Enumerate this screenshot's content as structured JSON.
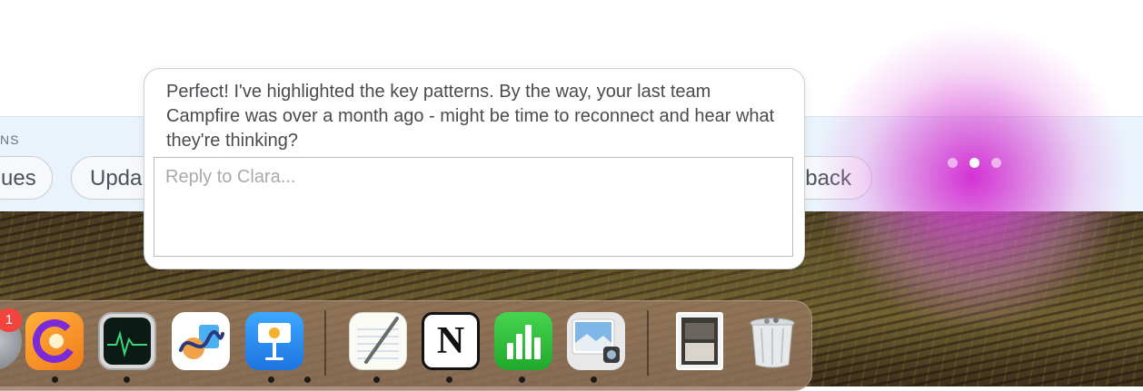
{
  "chat": {
    "message": "Perfect! I've highlighted the key patterns. By the way, your last team Campfire was over a month ago - might be time to reconnect and hear what they're thinking?",
    "reply_placeholder": "Reply to Clara..."
  },
  "suggestions": {
    "heading": "NS",
    "pills": [
      "ues",
      "Upda",
      "back"
    ]
  },
  "dock": {
    "badge_count": "1",
    "apps": [
      "system-settings",
      "clara",
      "activity-monitor",
      "freeform",
      "keynote",
      "textedit",
      "notion",
      "numbers",
      "preview",
      "finder-folder",
      "trash"
    ],
    "notion_letter": "N"
  },
  "colors": {
    "glow": "#d228d2",
    "badge": "#f2433d",
    "suggest_bar": "#eaf3fc"
  }
}
